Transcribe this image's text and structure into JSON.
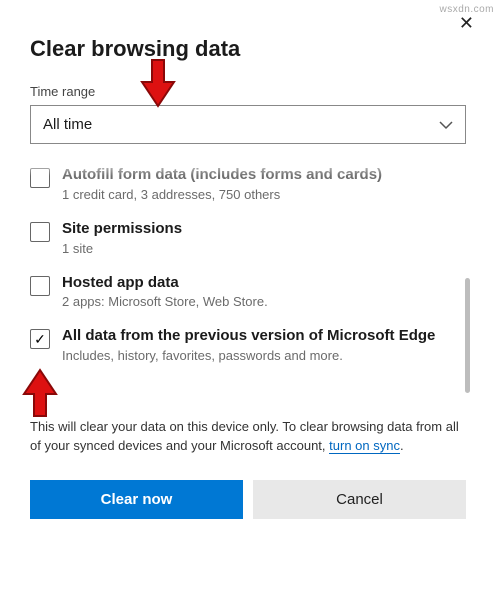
{
  "dialog": {
    "title": "Clear browsing data",
    "time_range_label": "Time range",
    "selected_range": "All time"
  },
  "items": [
    {
      "id": "autofill",
      "title": "Autofill form data (includes forms and cards)",
      "subtitle": "1 credit card, 3 addresses, 750 others",
      "checked": false
    },
    {
      "id": "site-permissions",
      "title": "Site permissions",
      "subtitle": "1 site",
      "checked": false
    },
    {
      "id": "hosted-app-data",
      "title": "Hosted app data",
      "subtitle": "2 apps: Microsoft Store, Web Store.",
      "checked": false
    },
    {
      "id": "previous-edge",
      "title": "All data from the previous version of Microsoft Edge",
      "subtitle": "Includes, history, favorites, passwords and more.",
      "checked": true
    }
  ],
  "notice": {
    "text_before": "This will clear your data on this device only. To clear browsing data from all of your synced devices and your Microsoft account, ",
    "link_text": "turn on sync",
    "text_after": "."
  },
  "buttons": {
    "primary": "Clear now",
    "secondary": "Cancel"
  },
  "watermark": "wsxdn.com"
}
